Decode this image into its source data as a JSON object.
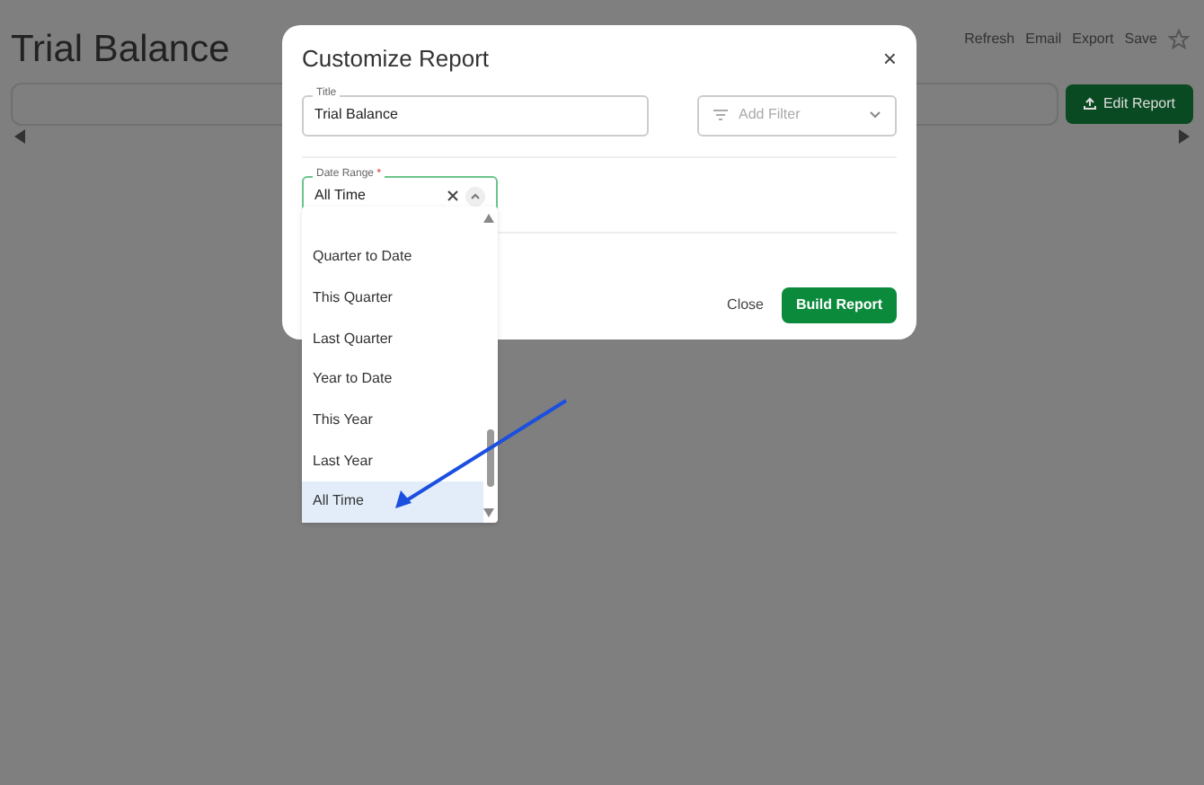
{
  "page": {
    "title": "Trial Balance",
    "actions": [
      "Refresh",
      "Email",
      "Export",
      "Save"
    ],
    "edit_button": "Edit Report"
  },
  "dialog": {
    "title": "Customize Report",
    "close_icon": "×",
    "title_field": {
      "label": "Title",
      "value": "Trial Balance"
    },
    "filter": {
      "placeholder": "Add Filter"
    },
    "date_range": {
      "label": "Date Range",
      "required_mark": "*",
      "value": "All Time",
      "expanded": true,
      "options": [
        {
          "label": "Quarter to Date",
          "selected": false
        },
        {
          "label": "This Quarter",
          "selected": false
        },
        {
          "label": "Last Quarter",
          "selected": false
        },
        {
          "label": "Year to Date",
          "selected": false
        },
        {
          "label": "This Year",
          "selected": false
        },
        {
          "label": "Last Year",
          "selected": false
        },
        {
          "label": "All Time",
          "selected": true
        }
      ]
    },
    "buttons": [
      "Close",
      "Build Report"
    ]
  }
}
